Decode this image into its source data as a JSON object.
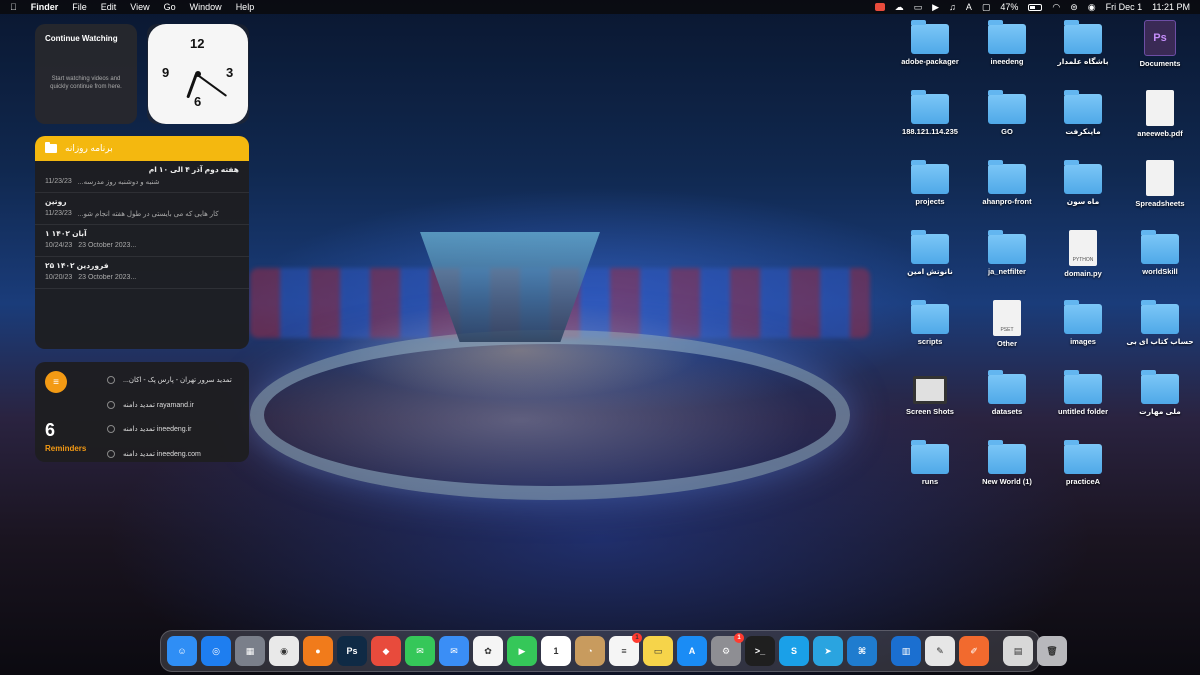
{
  "menubar": {
    "app_name": "Finder",
    "menus": [
      "File",
      "Edit",
      "View",
      "Go",
      "Window",
      "Help"
    ],
    "battery": "47%",
    "date": "Fri Dec 1",
    "time": "11:21 PM"
  },
  "widgets": {
    "continue_watching": {
      "title": "Continue Watching",
      "subtitle": "Start watching videos and quickly continue from here."
    },
    "clock": {
      "numbers": [
        "12",
        "3",
        "6",
        "9"
      ]
    },
    "notes": {
      "folder": "برنامه روزانه",
      "items": [
        {
          "title": "هفته دوم آذر ۴ الی ۱۰ ام",
          "date": "11/23/23",
          "preview": "شنبه و دوشنبه روز مدرسه..."
        },
        {
          "title": "روتین",
          "date": "11/23/23",
          "preview": "کار هایی که می بایستی در طول هفته انجام شو..."
        },
        {
          "title": "۱ آبان ۱۴۰۲",
          "date": "10/24/23",
          "preview": "23 October 2023..."
        },
        {
          "title": "۲۵ فروردین ۱۴۰۲",
          "date": "10/20/23",
          "preview": "23 October 2023..."
        }
      ]
    },
    "reminders": {
      "count": "6",
      "label": "Reminders",
      "items": [
        "تمدید سرور تهران - پارس پک - اکان...",
        "تمدید دامنه rayamand.ir",
        "تمدید دامنه ineedeng.ir",
        "تمدید دامنه ineedeng.com"
      ]
    }
  },
  "desktop_icons": [
    {
      "label": "adobe-packager",
      "type": "folder"
    },
    {
      "label": "ineedeng",
      "type": "folder"
    },
    {
      "label": "باشگاه علمدار",
      "type": "folder"
    },
    {
      "label": "Documents",
      "type": "ps"
    },
    {
      "label": "188.121.114.235",
      "type": "folder"
    },
    {
      "label": "GO",
      "type": "folder"
    },
    {
      "label": "ماینکرفت",
      "type": "folder"
    },
    {
      "label": "aneeweb.pdf",
      "type": "file"
    },
    {
      "label": "projects",
      "type": "folder"
    },
    {
      "label": "ahanpro-front",
      "type": "folder"
    },
    {
      "label": "ماه سون",
      "type": "folder"
    },
    {
      "label": "Spreadsheets",
      "type": "file"
    },
    {
      "label": "نانوتش امین",
      "type": "folder"
    },
    {
      "label": "ja_netfilter",
      "type": "folder"
    },
    {
      "label": "domain.py",
      "type": "file",
      "sub": "PYTHON"
    },
    {
      "label": "worldSkill",
      "type": "folder"
    },
    {
      "label": "scripts",
      "type": "folder"
    },
    {
      "label": "Other",
      "type": "file",
      "sub": "PSET"
    },
    {
      "label": "images",
      "type": "folder"
    },
    {
      "label": "حساب کتاب ای بی",
      "type": "folder"
    },
    {
      "label": "Screen Shots",
      "type": "screen"
    },
    {
      "label": "datasets",
      "type": "folder"
    },
    {
      "label": "untitled folder",
      "type": "folder"
    },
    {
      "label": "ملی مهارت",
      "type": "folder"
    },
    {
      "label": "runs",
      "type": "folder"
    },
    {
      "label": "New World (1)",
      "type": "folder"
    },
    {
      "label": "practiceA",
      "type": "folder"
    }
  ],
  "dock": {
    "apps": [
      {
        "name": "finder-icon",
        "glyph": "☺",
        "color": "#2f8ef5"
      },
      {
        "name": "safari-icon",
        "glyph": "◎",
        "color": "#1e7ef0"
      },
      {
        "name": "launchpad-icon",
        "glyph": "▦",
        "color": "#7a7f8a"
      },
      {
        "name": "chrome-icon",
        "glyph": "◉",
        "color": "#e9e9e9"
      },
      {
        "name": "firefox-icon",
        "glyph": "●",
        "color": "#f17b1b"
      },
      {
        "name": "photoshop-icon",
        "glyph": "Ps",
        "color": "#0f2a45"
      },
      {
        "name": "anydesk-icon",
        "glyph": "◆",
        "color": "#e84b3c"
      },
      {
        "name": "messages-icon",
        "glyph": "✉",
        "color": "#35c759"
      },
      {
        "name": "mail-icon",
        "glyph": "✉",
        "color": "#3a8ef6"
      },
      {
        "name": "photos-icon",
        "glyph": "✿",
        "color": "#f5f5f5"
      },
      {
        "name": "facetime-icon",
        "glyph": "▶",
        "color": "#35c759"
      },
      {
        "name": "calendar-icon",
        "glyph": "1",
        "color": "#ffffff"
      },
      {
        "name": "contacts-icon",
        "glyph": "◔",
        "color": "#c89b5e"
      },
      {
        "name": "reminders-icon",
        "glyph": "≡",
        "color": "#f5f5f5",
        "badge": "1"
      },
      {
        "name": "notes-icon",
        "glyph": "▭",
        "color": "#f6d44a"
      },
      {
        "name": "appstore-icon",
        "glyph": "A",
        "color": "#1a8cf5"
      },
      {
        "name": "settings-icon",
        "glyph": "⚙",
        "color": "#8e8e93",
        "badge": "1"
      },
      {
        "name": "terminal-icon",
        "glyph": ">_",
        "color": "#1f1f1f"
      },
      {
        "name": "skype-icon",
        "glyph": "S",
        "color": "#1aa0e8"
      },
      {
        "name": "telegram-icon",
        "glyph": "➤",
        "color": "#2aa4e0"
      },
      {
        "name": "vscode-icon",
        "glyph": "⌘",
        "color": "#1f7ccf"
      },
      {
        "name": "trello-icon",
        "glyph": "▥",
        "color": "#1b6fd0"
      },
      {
        "name": "textedit-icon",
        "glyph": "✎",
        "color": "#e6e6e6"
      },
      {
        "name": "pencil-app-icon",
        "glyph": "✐",
        "color": "#f26a2e"
      },
      {
        "name": "document-icon",
        "glyph": "▤",
        "color": "#d8d8d8"
      },
      {
        "name": "trash-icon",
        "glyph": "🗑",
        "color": "#b8b8bc"
      }
    ]
  }
}
